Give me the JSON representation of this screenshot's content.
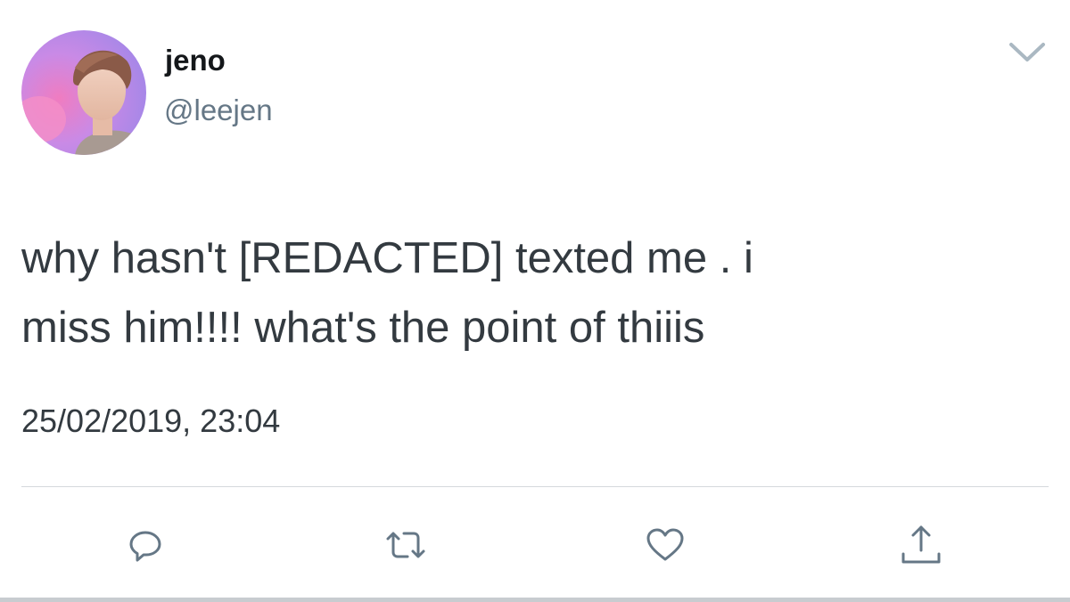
{
  "tweet": {
    "author": {
      "display_name": "jeno",
      "handle": "@leejen"
    },
    "text": "why hasn't [REDACTED] texted me . i\nmiss him!!!! what's the point of thiiis",
    "timestamp": "25/02/2019, 23:04"
  },
  "actions": [
    {
      "icon": "reply-icon"
    },
    {
      "icon": "retweet-icon"
    },
    {
      "icon": "like-icon"
    },
    {
      "icon": "share-icon"
    }
  ],
  "colors": {
    "text": "#333a40",
    "secondary": "#657786",
    "icon": "#657786",
    "divider": "#d5d8dc"
  }
}
